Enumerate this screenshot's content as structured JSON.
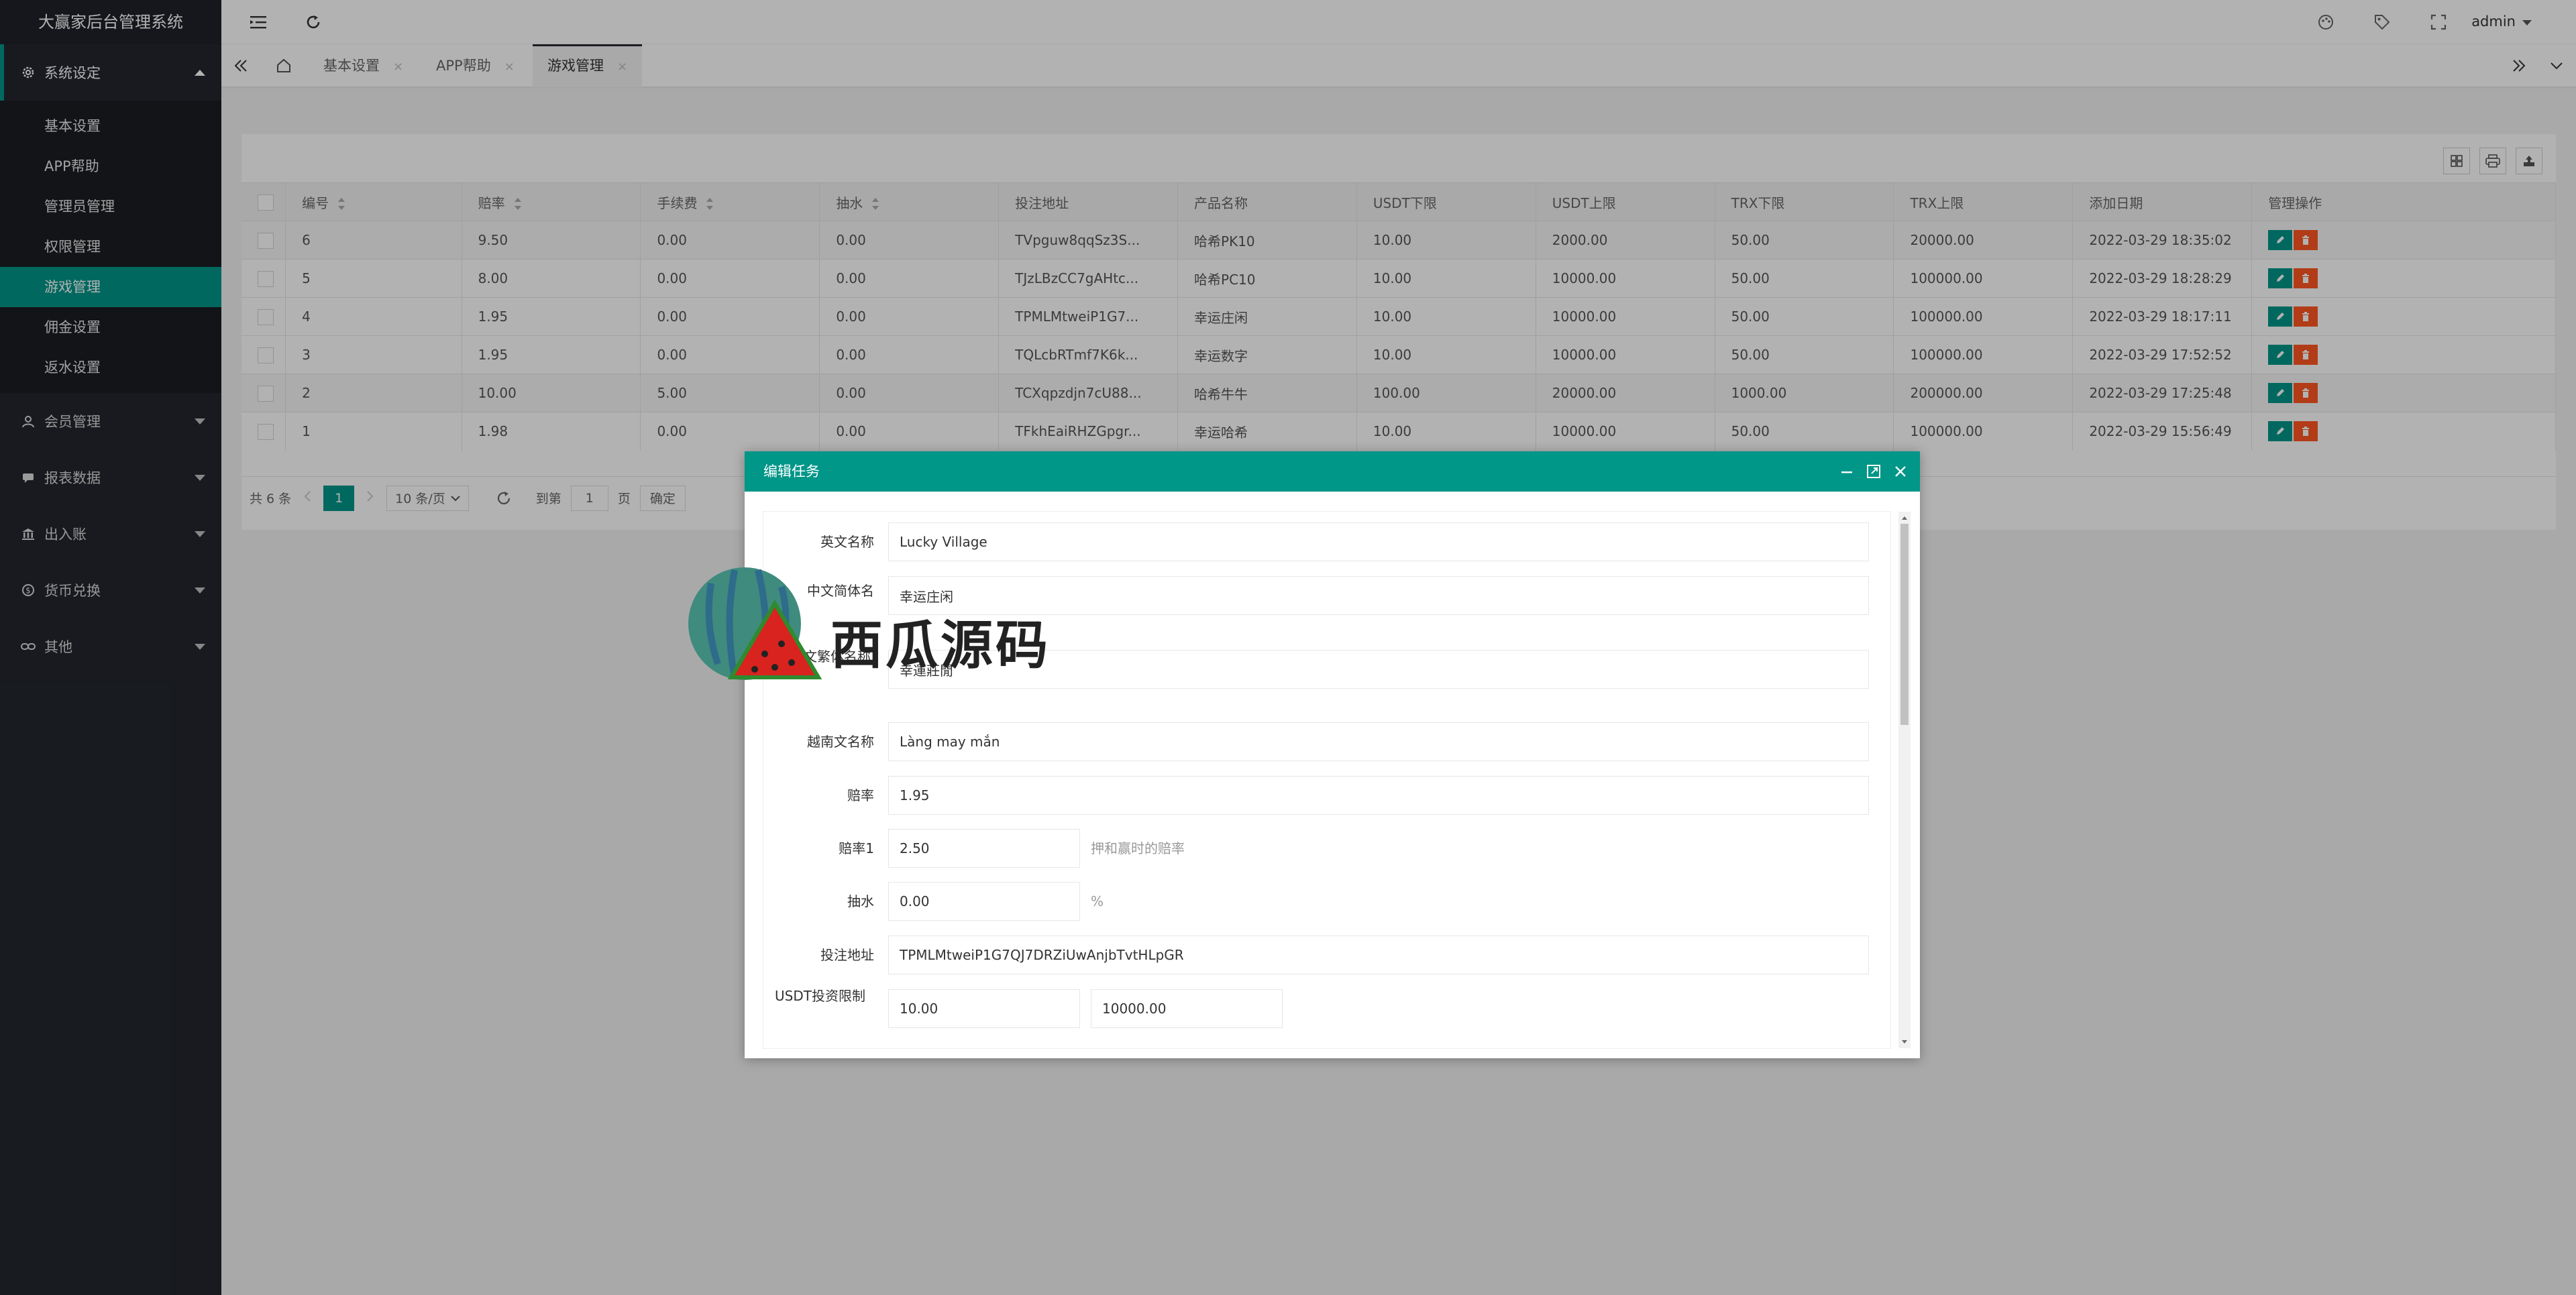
{
  "app": {
    "title": "大赢家后台管理系统"
  },
  "colors": {
    "accent": "#009688",
    "danger": "#ff5722",
    "sidebar": "#23262e"
  },
  "sidebar": {
    "system": "系统设定",
    "sub_items": [
      "基本设置",
      "APP帮助",
      "管理员管理",
      "权限管理",
      "游戏管理",
      "佣金设置",
      "返水设置"
    ],
    "groups": [
      "会员管理",
      "报表数据",
      "出入账",
      "货币兑换",
      "其他"
    ]
  },
  "header": {
    "user": "admin"
  },
  "tabs": [
    "基本设置",
    "APP帮助",
    "游戏管理"
  ],
  "tab_close": "×",
  "table": {
    "headers": [
      "编号",
      "赔率",
      "手续费",
      "抽水",
      "投注地址",
      "产品名称",
      "USDT下限",
      "USDT上限",
      "TRX下限",
      "TRX上限",
      "添加日期",
      "管理操作"
    ],
    "rows": [
      [
        "6",
        "9.50",
        "0.00",
        "0.00",
        "TVpguw8qqSz3S...",
        "哈希PK10",
        "10.00",
        "2000.00",
        "50.00",
        "20000.00",
        "2022-03-29 18:35:02"
      ],
      [
        "5",
        "8.00",
        "0.00",
        "0.00",
        "TJzLBzCC7gAHtc...",
        "哈希PC10",
        "10.00",
        "10000.00",
        "50.00",
        "100000.00",
        "2022-03-29 18:28:29"
      ],
      [
        "4",
        "1.95",
        "0.00",
        "0.00",
        "TPMLMtweiP1G7...",
        "幸运庄闲",
        "10.00",
        "10000.00",
        "50.00",
        "100000.00",
        "2022-03-29 18:17:11"
      ],
      [
        "3",
        "1.95",
        "0.00",
        "0.00",
        "TQLcbRTmf7K6k...",
        "幸运数字",
        "10.00",
        "10000.00",
        "50.00",
        "100000.00",
        "2022-03-29 17:52:52"
      ],
      [
        "2",
        "10.00",
        "5.00",
        "0.00",
        "TCXqpzdjn7cU88...",
        "哈希牛牛",
        "100.00",
        "20000.00",
        "1000.00",
        "200000.00",
        "2022-03-29 17:25:48"
      ],
      [
        "1",
        "1.98",
        "0.00",
        "0.00",
        "TFkhEaiRHZGpgr...",
        "幸运哈希",
        "10.00",
        "10000.00",
        "50.00",
        "100000.00",
        "2022-03-29 15:56:49"
      ]
    ]
  },
  "pager": {
    "total": "共 6 条",
    "current": "1",
    "per_page": "10 条/页",
    "goto_label": "到第",
    "goto_value": "1",
    "page_unit": "页",
    "confirm": "确定"
  },
  "modal": {
    "title": "编辑任务",
    "fields": {
      "en_name_label": "英文名称",
      "en_name": "Lucky Village",
      "zh_cn_label": "中文简体名",
      "zh_cn": "幸运庄闲",
      "zh_tw_label": "文繁体名称",
      "zh_tw": "幸運莊閒",
      "vi_label": "越南文名称",
      "vi": "Làng may mắn",
      "odds_label": "赔率",
      "odds": "1.95",
      "odds1_label": "赔率1",
      "odds1": "2.50",
      "odds1_hint": "押和赢时的赔率",
      "rake_label": "抽水",
      "rake": "0.00",
      "rake_unit": "%",
      "addr_label": "投注地址",
      "addr": "TPMLMtweiP1G7QJ7DRZiUwAnjbTvtHLpGR",
      "usdt_label": "USDT投资限制",
      "usdt_min": "10.00",
      "usdt_max": "10000.00"
    }
  },
  "watermark": {
    "text": "西瓜源码"
  }
}
